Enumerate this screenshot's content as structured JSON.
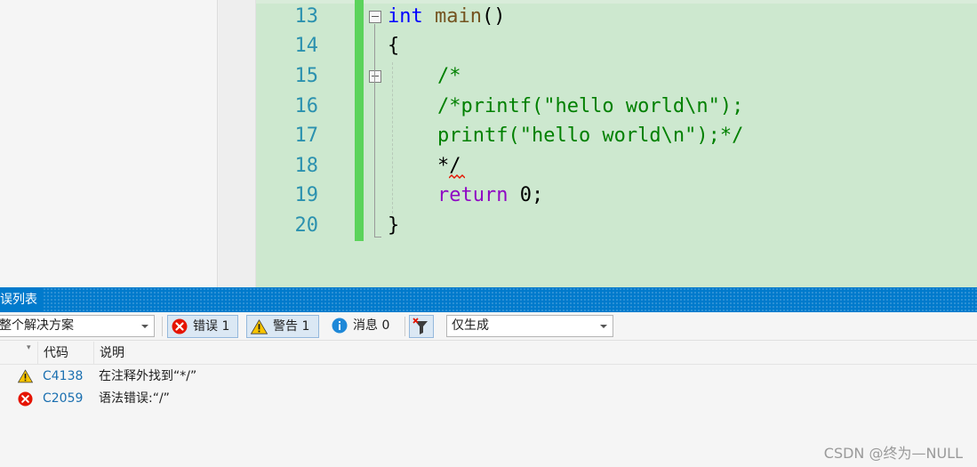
{
  "editor": {
    "lines": [
      {
        "num": "13"
      },
      {
        "num": "14"
      },
      {
        "num": "15"
      },
      {
        "num": "16"
      },
      {
        "num": "17"
      },
      {
        "num": "18"
      },
      {
        "num": "19"
      },
      {
        "num": "20"
      }
    ],
    "code": {
      "l13_kw": "int",
      "l13_fn": "main",
      "l13_paren": "()",
      "l14": "{",
      "l15": "/*",
      "l16": "/*printf(\"hello world\\n\");",
      "l17": "printf(\"hello world\\n\");*/",
      "l18": "*/",
      "l19_kw": "return",
      "l19_rest": " 0;",
      "l20": "}"
    },
    "colors": {
      "keyword": "#0000ff",
      "comment": "#008000",
      "control_keyword": "#8f08c4",
      "line_number": "#2b91af",
      "changed_bar": "#5bd35b"
    }
  },
  "error_list": {
    "title": "误列表",
    "scope_value": "整个解决方案",
    "errors_label": "错误 1",
    "warnings_label": "警告 1",
    "messages_label": "消息 0",
    "build_filter_value": "仅生成",
    "headers": {
      "code": "代码",
      "description": "说明"
    },
    "rows": [
      {
        "icon": "warning-icon",
        "code": "C4138",
        "description": "在注释外找到“*/”"
      },
      {
        "icon": "error-icon",
        "code": "C2059",
        "description": "语法错误:“/”"
      }
    ]
  },
  "watermark": "CSDN @终为—NULL"
}
